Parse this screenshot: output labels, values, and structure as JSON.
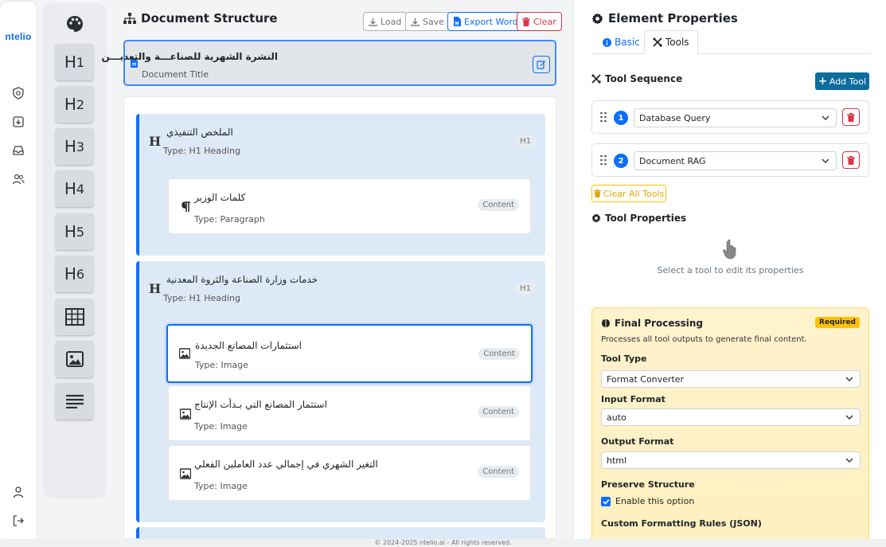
{
  "app": {
    "logo_text": "ntelio"
  },
  "rail": {
    "icons": [
      "shield-icon",
      "download-icon",
      "inbox-icon",
      "users-icon",
      "user-icon",
      "logout-icon"
    ]
  },
  "palette": {
    "top_icon": "palette-icon",
    "headings": [
      {
        "h": "H",
        "n": "1"
      },
      {
        "h": "H",
        "n": "2"
      },
      {
        "h": "H",
        "n": "3"
      },
      {
        "h": "H",
        "n": "4"
      },
      {
        "h": "H",
        "n": "5"
      },
      {
        "h": "H",
        "n": "6"
      }
    ],
    "extra_tiles": [
      "table-icon",
      "image-icon",
      "paragraph-icon"
    ]
  },
  "structure": {
    "title": "Document Structure",
    "buttons": {
      "load": "Load",
      "save": "Save",
      "export": "Export Word",
      "clear": "Clear"
    },
    "doc_title": {
      "text": "النشرة الشهرية للصناعـــة والتعديـــن",
      "label": "Document Title"
    },
    "sections": [
      {
        "name": "الملخص التنفيذي",
        "type": "Type: H1 Heading",
        "tag": "H1",
        "children": [
          {
            "name": "كلمات الوزير",
            "type": "Type: Paragraph",
            "tag": "Content"
          }
        ]
      },
      {
        "name": "خدمات وزارة الصناعة والثروة المعدنية",
        "type": "Type: H1 Heading",
        "tag": "H1",
        "children": [
          {
            "name": "استثمارات المصانع الجديدة",
            "type": "Type: Image",
            "tag": "Content"
          },
          {
            "name": "استثمار المصانع التي بـدأت الإنتاج",
            "type": "Type: Image",
            "tag": "Content"
          },
          {
            "name": "التغير الشهري في إجمالي عدد العاملين الفعلي",
            "type": "Type: Image",
            "tag": "Content"
          }
        ]
      }
    ]
  },
  "properties": {
    "title": "Element Properties",
    "tabs": {
      "basic": "Basic",
      "tools": "Tools"
    },
    "tool_sequence": {
      "title": "Tool Sequence",
      "add_label": "Add Tool",
      "tools": [
        {
          "num": "1",
          "value": "Database Query"
        },
        {
          "num": "2",
          "value": "Document RAG"
        }
      ],
      "clear_all": "Clear All Tools"
    },
    "tool_properties": {
      "title": "Tool Properties",
      "hint": "Select a tool to edit its properties"
    },
    "final": {
      "title": "Final Processing",
      "badge": "Required",
      "desc": "Processes all tool outputs to generate final content.",
      "tool_type_label": "Tool Type",
      "tool_type_value": "Format Converter",
      "input_label": "Input Format",
      "input_value": "auto",
      "output_label": "Output Format",
      "output_value": "html",
      "preserve_label": "Preserve Structure",
      "preserve_option": "Enable this option",
      "preserve_checked": true,
      "rules_label": "Custom Formatting Rules (JSON)"
    }
  },
  "footer": "© 2024-2025 ntelio.ai - All rights reserved.",
  "colors": {
    "primary": "#0d6efd",
    "danger": "#dc3545",
    "warning": "#ffc107",
    "section_bg": "#dde9f7"
  }
}
